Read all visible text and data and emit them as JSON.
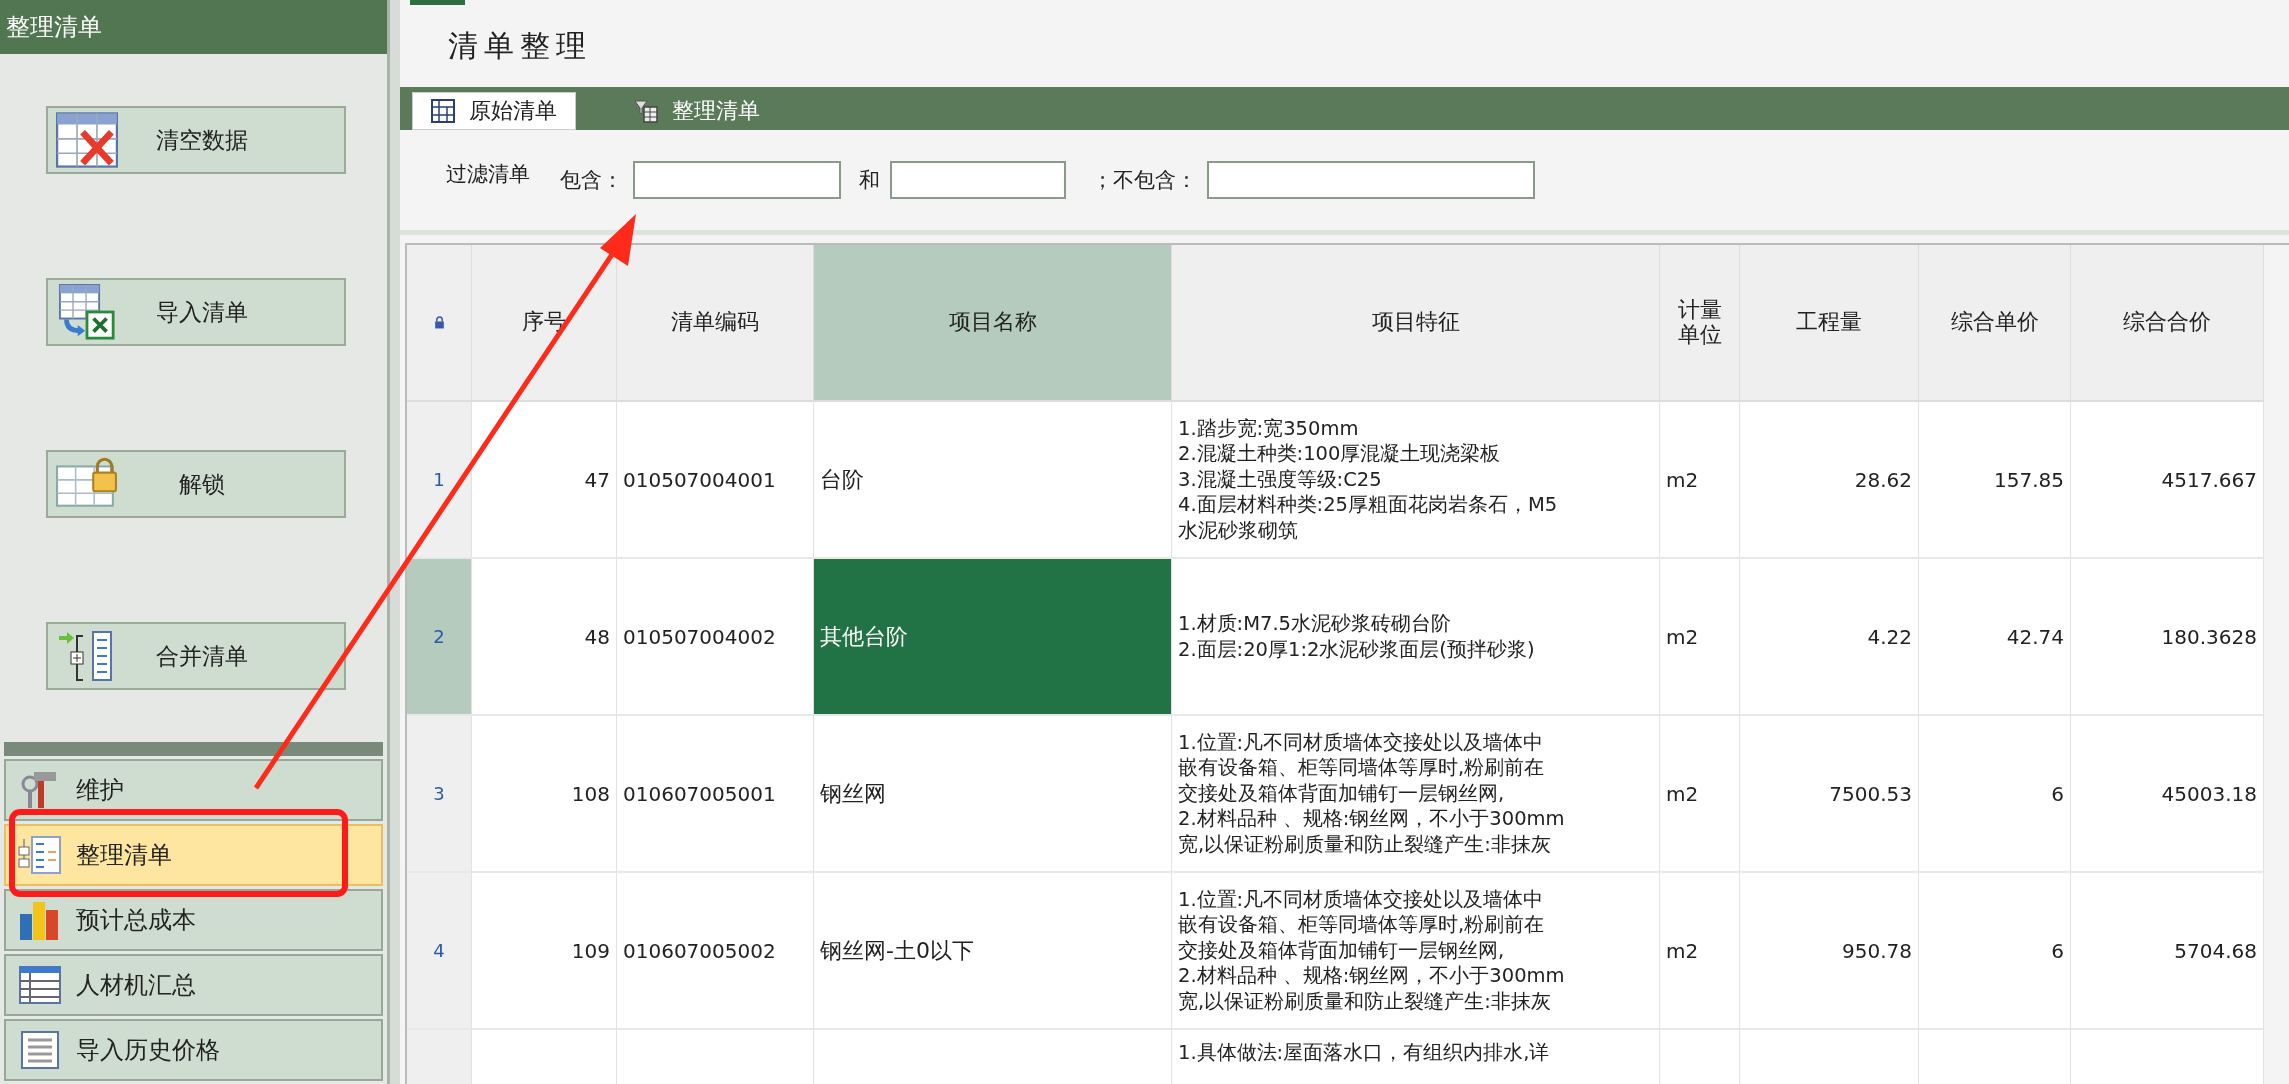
{
  "sidebar": {
    "title": "整理清单",
    "actions": [
      {
        "label": "清空数据",
        "kind": "clear"
      },
      {
        "label": "导入清单",
        "kind": "import"
      },
      {
        "label": "解锁",
        "kind": "unlock"
      },
      {
        "label": "合并清单",
        "kind": "merge"
      }
    ],
    "nav": [
      {
        "label": "维护",
        "kind": "tools",
        "selected": false
      },
      {
        "label": "整理清单",
        "kind": "organize",
        "selected": true
      },
      {
        "label": "预计总成本",
        "kind": "chart",
        "selected": false
      },
      {
        "label": "人材机汇总",
        "kind": "summary",
        "selected": false
      },
      {
        "label": "导入历史价格",
        "kind": "history",
        "selected": false
      }
    ]
  },
  "page": {
    "title": "清单整理",
    "tabs": [
      {
        "label": "原始清单",
        "kind": "grid",
        "selected": true
      },
      {
        "label": "整理清单",
        "kind": "filter",
        "selected": false
      }
    ],
    "filter": {
      "label": "过滤清单",
      "include_label": "包含：",
      "and_label": "和",
      "exclude_label": "；不包含："
    }
  },
  "table": {
    "columns": [
      {
        "kind": "lock",
        "selected": false
      },
      {
        "label": "序号",
        "kind": "num",
        "selected": false
      },
      {
        "label": "清单编码",
        "kind": "code",
        "selected": false
      },
      {
        "label": "项目名称",
        "kind": "name",
        "selected": true
      },
      {
        "label": "项目特征",
        "kind": "feature",
        "selected": false
      },
      {
        "label": "计量单位",
        "kind": "unit",
        "selected": false
      },
      {
        "label": "工程量",
        "kind": "qty",
        "selected": false
      },
      {
        "label": "综合单价",
        "kind": "price",
        "selected": false
      },
      {
        "label": "综合合价",
        "kind": "total",
        "selected": false
      }
    ],
    "rows": [
      {
        "index": "1",
        "no": "47",
        "code": "010507004001",
        "name": "台阶",
        "features": [
          "1.踏步宽:宽350mm",
          "2.混凝土种类:100厚混凝土现浇梁板",
          "3.混凝土强度等级:C25",
          "4.面层材料种类:25厚粗面花岗岩条石，M5",
          "水泥砂浆砌筑"
        ],
        "unit": "m2",
        "qty": "28.62",
        "price": "157.85",
        "total": "4517.667",
        "selected": false
      },
      {
        "index": "2",
        "no": "48",
        "code": "010507004002",
        "name": "其他台阶",
        "features": [
          "1.材质:M7.5水泥砂浆砖砌台阶",
          "2.面层:20厚1:2水泥砂浆面层(预拌砂浆)"
        ],
        "unit": "m2",
        "qty": "4.22",
        "price": "42.74",
        "total": "180.3628",
        "selected": true
      },
      {
        "index": "3",
        "no": "108",
        "code": "010607005001",
        "name": "钢丝网",
        "features": [
          "1.位置:凡不同材质墙体交接处以及墙体中",
          "嵌有设备箱、柜等同墙体等厚时,粉刷前在",
          "交接处及箱体背面加铺钉一层钢丝网,",
          "2.材料品种 、规格:钢丝网，不小于300mm",
          "宽,以保证粉刷质量和防止裂缝产生:非抹灰"
        ],
        "unit": "m2",
        "qty": "7500.53",
        "price": "6",
        "total": "45003.18",
        "selected": false
      },
      {
        "index": "4",
        "no": "109",
        "code": "010607005002",
        "name": "钢丝网-土0以下",
        "features": [
          "1.位置:凡不同材质墙体交接处以及墙体中",
          "嵌有设备箱、柜等同墙体等厚时,粉刷前在",
          "交接处及箱体背面加铺钉一层钢丝网,",
          "2.材料品种 、规格:钢丝网，不小于300mm",
          "宽,以保证粉刷质量和防止裂缝产生:非抹灰"
        ],
        "unit": "m2",
        "qty": "950.78",
        "price": "6",
        "total": "5704.68",
        "selected": false
      },
      {
        "features": [
          "1.具体做法:屋面落水口，有组织内排水,详"
        ],
        "selected": false
      }
    ]
  }
}
